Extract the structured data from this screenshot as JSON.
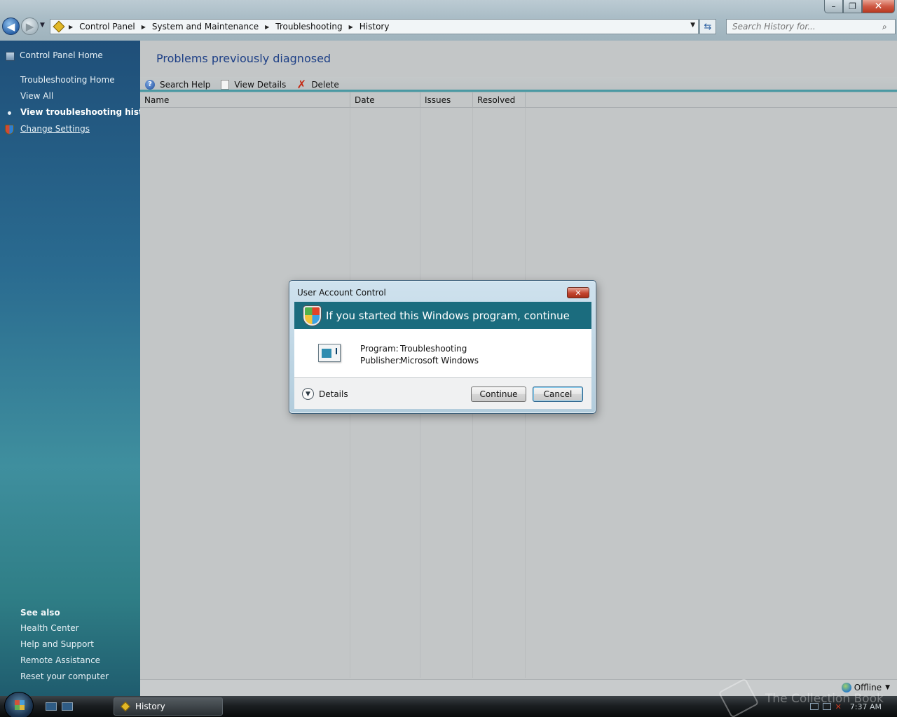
{
  "window": {
    "minimize": "–",
    "maximize": "❐",
    "close": "✕"
  },
  "address": {
    "breadcrumbs": [
      "Control Panel",
      "System and Maintenance",
      "Troubleshooting",
      "History"
    ],
    "search_placeholder": "Search History for..."
  },
  "sidebar": {
    "home": "Control Panel Home",
    "links": [
      "Troubleshooting Home",
      "View All",
      "View troubleshooting history",
      "Change Settings"
    ],
    "see_also_title": "See also",
    "see_also": [
      "Health Center",
      "Help and Support",
      "Remote Assistance",
      "Reset your computer"
    ]
  },
  "main": {
    "title": "Problems previously diagnosed",
    "toolbar": {
      "search_help": "Search Help",
      "view_details": "View Details",
      "delete": "Delete"
    },
    "columns": [
      "Name",
      "Date",
      "Issues",
      "Resolved"
    ],
    "status": "Offline"
  },
  "dialog": {
    "title": "User Account Control",
    "heading": "If you started this Windows program, continue",
    "program_label": "Program:",
    "program_value": "Troubleshooting",
    "publisher_label": "Publisher:",
    "publisher_value": "Microsoft Windows",
    "details": "Details",
    "continue": "Continue",
    "cancel": "Cancel"
  },
  "taskbar": {
    "task": "History",
    "time": "7:37 AM"
  },
  "watermark": "The Collection Book"
}
